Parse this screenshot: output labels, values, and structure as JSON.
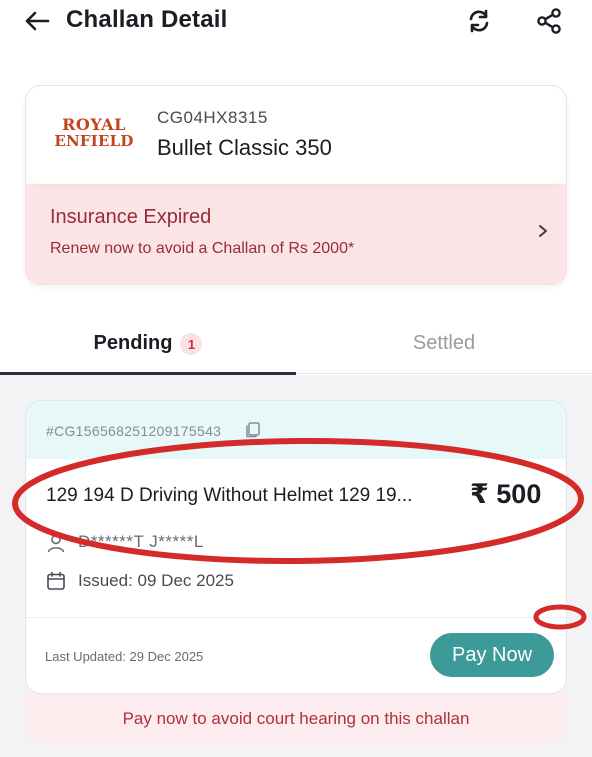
{
  "header": {
    "title": "Challan Detail",
    "back_icon": "arrow-left-icon",
    "refresh_icon": "refresh-icon",
    "share_icon": "share-icon"
  },
  "vehicle": {
    "brand_line1": "ROYAL",
    "brand_line2": "ENFIELD",
    "registration": "CG04HX8315",
    "model": "Bullet Classic 350"
  },
  "insurance": {
    "title": "Insurance Expired",
    "subtitle": "Renew now to avoid a Challan of Rs 2000*",
    "chevron_icon": "chevron-right-icon"
  },
  "tabs": {
    "pending_label": "Pending",
    "pending_count": "1",
    "settled_label": "Settled"
  },
  "challan": {
    "id": "#CG156568251209175543",
    "offence": "129 194 D Driving Without Helmet 129 19...",
    "amount": "₹ 500",
    "accused": "D******T J*****L",
    "issued": "Issued: 09 Dec 2025",
    "last_updated": "Last Updated: 29 Dec 2025",
    "pay_button": "Pay Now",
    "court_warning": "Pay now to avoid court hearing on this challan"
  },
  "colors": {
    "accent_teal": "#3c9b98",
    "warning_red": "#9b2b36",
    "annotation_red": "#d42a2a",
    "brand_orange": "#c3431d"
  }
}
